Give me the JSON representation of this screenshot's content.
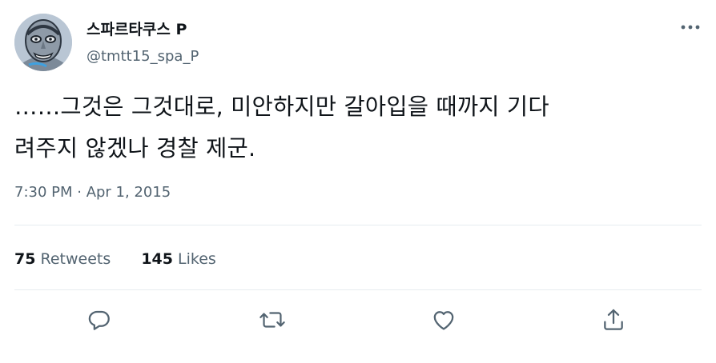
{
  "user": {
    "display_name": "스파르타쿠스 P",
    "handle": "@tmtt15_spa_P"
  },
  "tweet": {
    "text_lines": [
      "……그것은 그것대로, 미안하지만 갈아입을 때까지 기다",
      "려주지 않겠나 경찰 제군."
    ],
    "timestamp": "7:30 PM · Apr 1, 2015"
  },
  "stats": {
    "retweets_count": "75",
    "retweets_label": "Retweets",
    "likes_count": "145",
    "likes_label": "Likes"
  },
  "icons": {
    "more": "more-icon",
    "reply": "reply-icon",
    "retweet": "retweet-icon",
    "like": "like-icon",
    "share": "share-icon"
  },
  "colors": {
    "text_primary": "#0f1419",
    "text_secondary": "#536471",
    "divider": "#e6ecf0"
  }
}
